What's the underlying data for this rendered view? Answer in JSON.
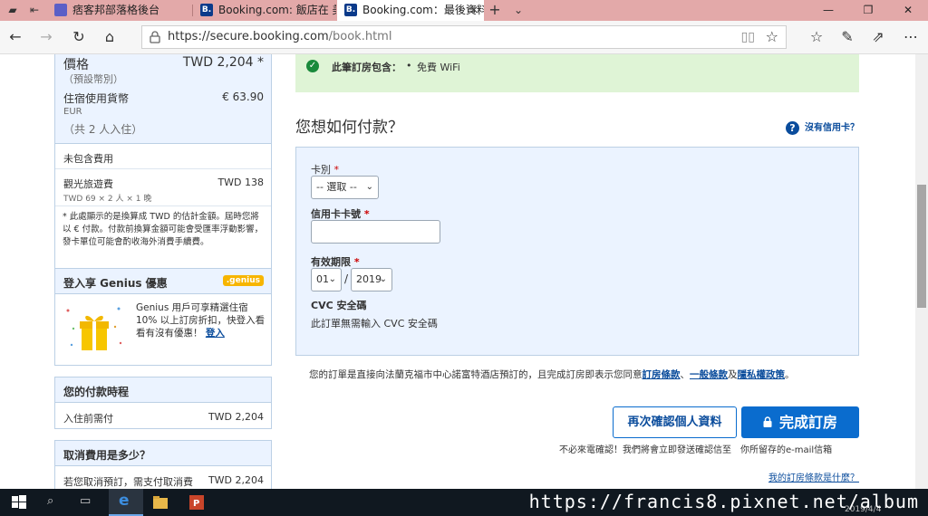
{
  "tabs": [
    {
      "label": "痞客邦部落格後台",
      "favicon_color": "#5b5fc7",
      "favicon_text": ""
    },
    {
      "label": "Booking.com: 飯店在 美國洛",
      "favicon_color": "#0a3a8a",
      "favicon_text": "B."
    },
    {
      "label": "Booking.com：最後資料",
      "favicon_color": "#0a3a8a",
      "favicon_text": "B.",
      "active": true
    }
  ],
  "new_tab": "+",
  "window_controls": [
    "—",
    "❐",
    "✕"
  ],
  "address": {
    "host": "https://secure.booking.com",
    "path": "/book.html"
  },
  "sidebar": {
    "price": {
      "label": "價格",
      "sublabel": "（預設幣別）",
      "value": "TWD 2,204 *",
      "accommodation_label": "住宿使用貨幣",
      "accommodation_value": "€ 63.90",
      "accommodation_currency": "EUR",
      "guests": "（共 2 人入住）",
      "excluded_label": "未包含費用",
      "tax_label": "觀光旅遊費",
      "tax_value": "TWD 138",
      "tax_detail": "TWD 69 × 2 人 × 1 晚",
      "note": "* 此處顯示的是換算成 TWD 的估計金額。屆時您將以 € 付款。付款前換算金額可能會受匯率浮動影響，發卡單位可能會酌收海外消費手續費。"
    },
    "genius": {
      "title": "登入享 Genius 優惠",
      "badge": ".genius",
      "text": "Genius 用戶可享精選住宿 10% 以上訂房折扣，快登入看看有沒有優惠！",
      "login_link": "登入"
    },
    "schedule": {
      "title": "您的付款時程",
      "label": "入住前需付",
      "value": "TWD 2,204"
    },
    "cancel": {
      "title": "取消費用是多少？",
      "label": "若您取消預訂，需支付取消費",
      "value": "TWD 2,204"
    }
  },
  "main": {
    "wifi_banner": {
      "label": "此筆訂房包含：",
      "item": "免費 WiFi"
    },
    "payment_title": "您想如何付款？",
    "no_card_link": "沒有信用卡？",
    "form": {
      "card_type_label": "卡別",
      "card_type_value": "-- 選取 --",
      "card_number_label": "信用卡卡號",
      "card_number_value": "",
      "expiry_label": "有效期限",
      "expiry_month": "01",
      "expiry_year": "2019",
      "expiry_sep": "/",
      "cvc_label": "CVC 安全碼",
      "cvc_note": "此訂單無需輸入 CVC 安全碼",
      "required_mark": "*"
    },
    "terms": {
      "prefix": "您的訂單是直接向法蘭克福市中心諾富特酒店預訂的，且完成訂房即表示您同意",
      "link1": "訂房條款",
      "sep1": "、",
      "link2": "一般條款",
      "sep2": "及",
      "link3": "隱私權政策",
      "suffix": "。"
    },
    "recheck_button": "再次確認個人資料",
    "complete_button": "完成訂房",
    "confirm_note": "不必來電確認！我們將會立即發送確認信至　你所留存的e-mail信箱",
    "booking_terms_link": "我的訂房條款是什麼？"
  },
  "taskbar": {
    "watermark": "https://francis8.pixnet.net/album",
    "date": "2019/4/4"
  },
  "colors": {
    "brand_blue": "#0a6cce",
    "link_blue": "#0a4c9c",
    "panel_blue": "#ebf3ff",
    "success_green": "#dff4d6",
    "tab_strip": "#e3a9a9"
  }
}
